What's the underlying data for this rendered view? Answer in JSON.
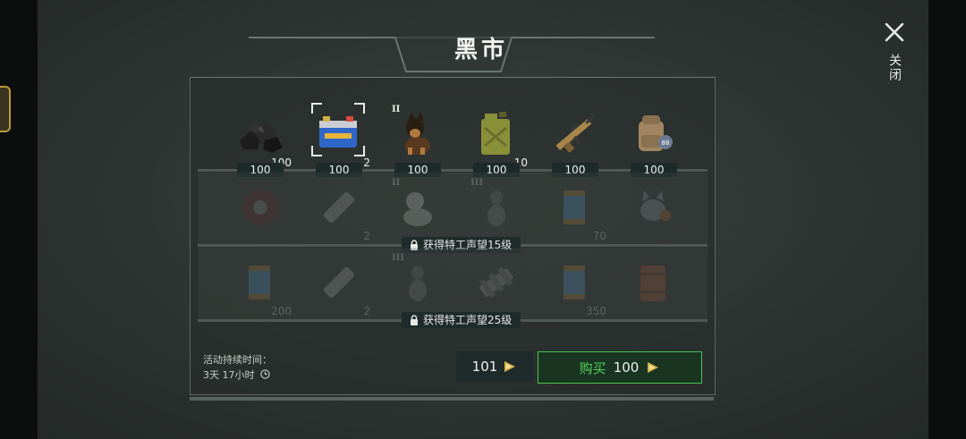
{
  "title": "黑市",
  "close_label": "关闭",
  "rows": [
    {
      "locked": false,
      "items": [
        {
          "icon": "coal-icon",
          "qty": "100",
          "tier": "",
          "price": "100"
        },
        {
          "icon": "car-battery-icon",
          "qty": "2",
          "tier": "",
          "price": "100",
          "selected": true
        },
        {
          "icon": "dog-icon",
          "qty": "",
          "tier": "II",
          "price": "100"
        },
        {
          "icon": "jerry-can-icon",
          "qty": "10",
          "tier": "",
          "price": "100"
        },
        {
          "icon": "rifle-icon",
          "qty": "",
          "tier": "",
          "price": "100"
        },
        {
          "icon": "backpack-icon",
          "qty": "",
          "tier": "",
          "price": "100"
        }
      ],
      "unlock_label": ""
    },
    {
      "locked": true,
      "items": [
        {
          "icon": "round-mine-icon",
          "qty": "",
          "tier": ""
        },
        {
          "icon": "pipe-icon",
          "qty": "2",
          "tier": ""
        },
        {
          "icon": "dog-icon",
          "qty": "",
          "tier": "II"
        },
        {
          "icon": "dog-sitting-icon",
          "qty": "",
          "tier": "III"
        },
        {
          "icon": "canister-icon",
          "qty": "70",
          "tier": ""
        },
        {
          "icon": "cat-icon",
          "qty": "",
          "tier": ""
        }
      ],
      "unlock_label": "获得特工声望15级"
    },
    {
      "locked": true,
      "items": [
        {
          "icon": "canister-icon",
          "qty": "200",
          "tier": ""
        },
        {
          "icon": "pipe-icon",
          "qty": "2",
          "tier": ""
        },
        {
          "icon": "dog-sitting-icon",
          "qty": "",
          "tier": "III"
        },
        {
          "icon": "engine-part-icon",
          "qty": "",
          "tier": ""
        },
        {
          "icon": "canister-icon",
          "qty": "350",
          "tier": ""
        },
        {
          "icon": "barrel-icon",
          "qty": "",
          "tier": ""
        }
      ],
      "unlock_label": "获得特工声望25级"
    }
  ],
  "event": {
    "label": "活动持续时间：",
    "time": "3天 17小时"
  },
  "balance": "101",
  "buy": {
    "label": "购买",
    "price": "100"
  },
  "colors": {
    "accent_green": "#49c44e",
    "gold_coin": "#d8b24a"
  }
}
